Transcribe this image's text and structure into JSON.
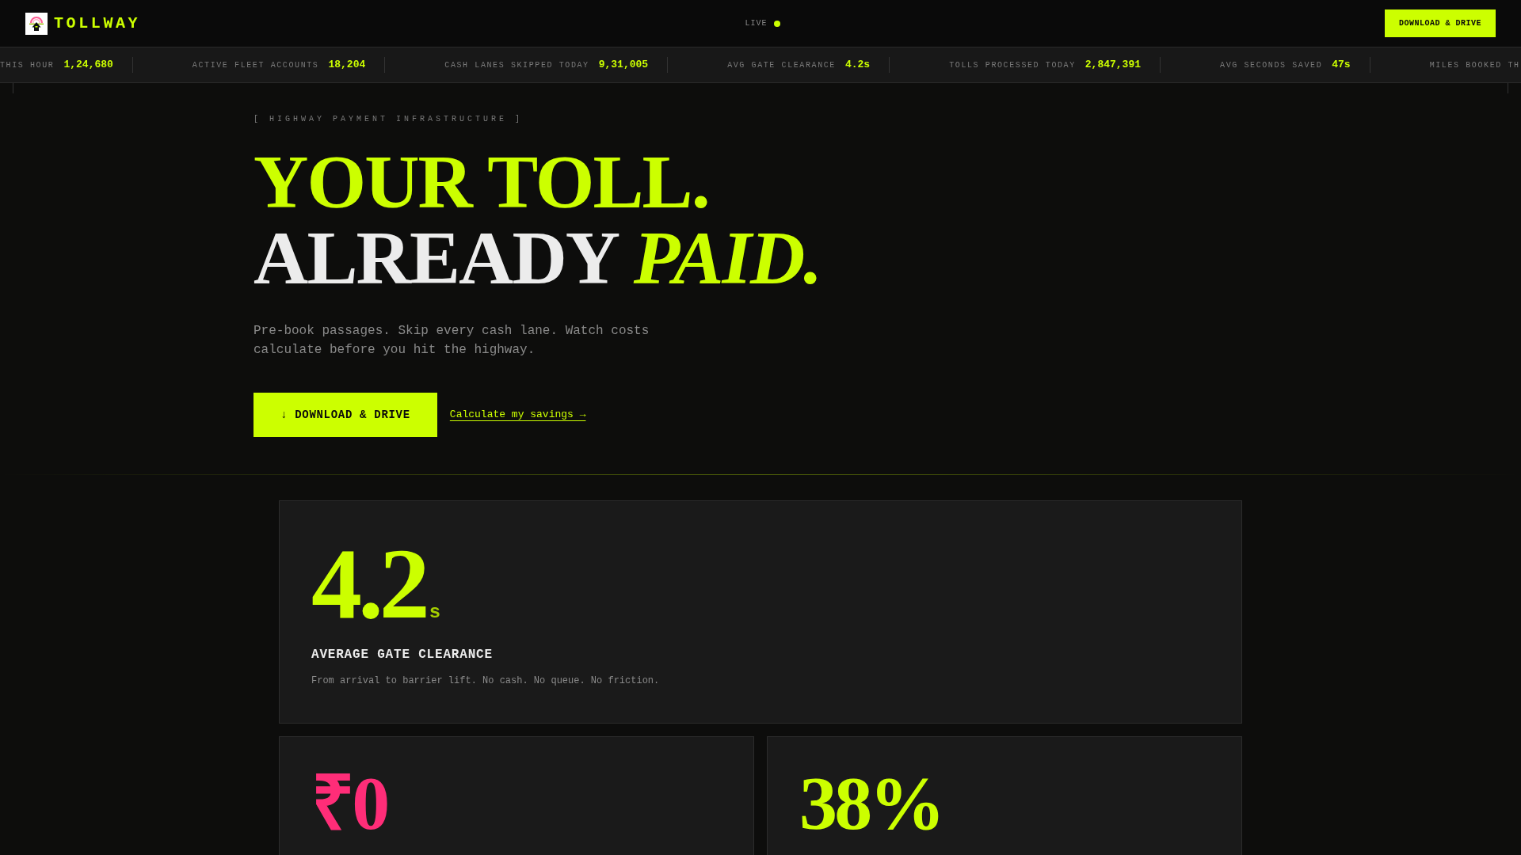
{
  "nav": {
    "brand": "TOLLWAY",
    "live_label": "LIVE",
    "cta": "DOWNLOAD & DRIVE"
  },
  "ticker": [
    {
      "label": "THIS HOUR",
      "value": "1,24,680"
    },
    {
      "label": "ACTIVE FLEET ACCOUNTS",
      "value": "18,204"
    },
    {
      "label": "CASH LANES SKIPPED TODAY",
      "value": "9,31,005"
    },
    {
      "label": "AVG GATE CLEARANCE",
      "value": "4.2s"
    },
    {
      "label": "TOLLS PROCESSED TODAY",
      "value": "2,847,391"
    },
    {
      "label": "AVG SECONDS SAVED",
      "value": "47s"
    },
    {
      "label": "MILES BOOKED TH"
    }
  ],
  "hero": {
    "eyebrow": "[ HIGHWAY PAYMENT INFRASTRUCTURE ]",
    "headline": [
      "YOUR TOLL.",
      "ALREADY *PAID.*"
    ],
    "subtitle": "Pre-book passages. Skip every cash lane. Watch costs calculate before you hit the highway.",
    "primary_button": "↓ DOWNLOAD & DRIVE",
    "link": "Calculate my savings →"
  },
  "featured_stat": {
    "value": "4.2",
    "unit": "s",
    "title": "AVERAGE GATE CLEARANCE",
    "description": "From arrival to barrier lift. No cash. No queue. No friction."
  },
  "stats": [
    {
      "value": "₹0",
      "color": "#ff2d78"
    },
    {
      "value": "38%",
      "color": "#ccff00"
    }
  ]
}
